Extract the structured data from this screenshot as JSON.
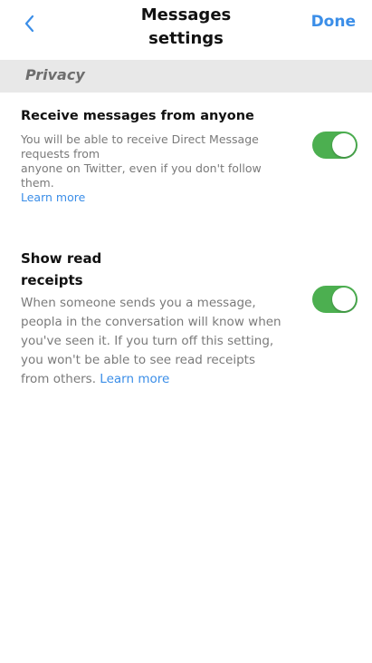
{
  "header": {
    "title_line1": "Messages",
    "title_line2": "settings",
    "done_label": "Done",
    "back_icon": "chevron-left-icon"
  },
  "section": {
    "label": "Privacy"
  },
  "settings": [
    {
      "title": "Receive messages from anyone",
      "desc_line1": "You will be able to receive Direct Message",
      "desc_line2": "requests from",
      "desc_line3": "anyone on Twitter, even if you don't follow",
      "desc_line4": "them.",
      "link": "Learn more",
      "enabled": true
    },
    {
      "title_line1": "Show read",
      "title_line2": "receipts",
      "desc_line1": "When someone sends you a message,",
      "desc_line2": "peopla in the conversation will know when",
      "desc_line3": "you've seen it. If you turn off this setting,",
      "desc_line4": "you won't be able to see read receipts",
      "desc_line5": "from others.",
      "link": "Learn more",
      "enabled": true
    }
  ],
  "colors": {
    "accent": "#3b8ee8",
    "toggle_on": "#4caf50",
    "section_bg": "#e8e8e8"
  }
}
